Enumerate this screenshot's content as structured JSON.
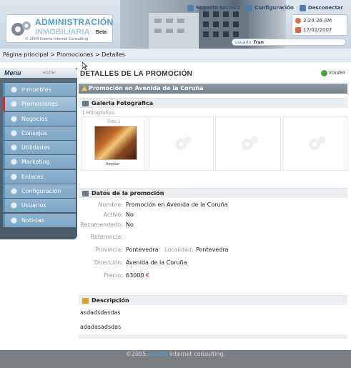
{
  "header": {
    "logo_line1": "ADMINISTRACIÓN",
    "logo_line2": "INMOBILIARIA",
    "logo_beta": "Beta",
    "logo_copyright": "© 2004 Inserta Internet Consulting",
    "nav": [
      {
        "label": "Soporte técnico",
        "icon": "support-icon"
      },
      {
        "label": "Configuración",
        "icon": "settings-icon"
      },
      {
        "label": "Desconectar",
        "icon": "logout-icon"
      }
    ],
    "time": "2:24:26 AM",
    "date": "17/02/2007",
    "user_label": "usuario:",
    "user_name": "fran"
  },
  "breadcrumb": "Página principal > Promociones > Detalles",
  "menu": {
    "title": "Menu",
    "hide_label": "ocultar",
    "items": [
      {
        "label": "Inmuebles",
        "active": false
      },
      {
        "label": "Promociones",
        "active": true
      },
      {
        "label": "Negocios",
        "active": false
      },
      {
        "label": "Consejos",
        "active": false
      },
      {
        "label": "Utilidades",
        "active": false
      },
      {
        "label": "Marketing",
        "active": false
      },
      {
        "label": "Enlaces",
        "active": false
      },
      {
        "label": "Configuración",
        "active": false
      },
      {
        "label": "Usuarios",
        "active": false
      },
      {
        "label": "Noticias",
        "active": false
      }
    ]
  },
  "content": {
    "title": "DETALLES DE LA PROMOCIÓN",
    "back_label": "VOLVER",
    "promo_bar": "Promoción en Avenida de la Coruña",
    "gallery": {
      "title": "Galeria Fotografica",
      "count": "1 Fotografías.",
      "photo_label": "Foto 1",
      "enlarge_label": "Ampliar"
    },
    "details": {
      "title": "Datos de la promoción",
      "nombre_label": "Nombre:",
      "nombre_value": "Promoción en Avenida de la Coruña",
      "activo_label": "Activo:",
      "activo_value": "No",
      "recomendado_label": "Recomendado:",
      "recomendado_value": "No",
      "referencia_label": "Referencia:",
      "referencia_value": "",
      "provincia_label": "Provincia:",
      "provincia_value": "Pontevedra",
      "localidad_label": "Localidad:",
      "localidad_value": "Pontevedra",
      "direccion_label": "Dirección:",
      "direccion_value": "Avenida de la Coruña",
      "precio_label": "Precio:",
      "precio_value": "63000",
      "precio_currency": "€"
    },
    "description": {
      "title": "Descripción",
      "line1": "asdadsdasdas",
      "line2": "adadasadsdas"
    }
  },
  "footer": {
    "prefix": "©2005,",
    "brand": "inserta",
    "suffix": "internet consulting."
  },
  "colors": {
    "menu_bg": "#5d6d7c",
    "menu_item": "#8eb4d0",
    "active_marker": "#d12d2d",
    "section_bar": "#8d9aa6",
    "price": "#c62020",
    "footer_bg": "#7a7f84"
  }
}
